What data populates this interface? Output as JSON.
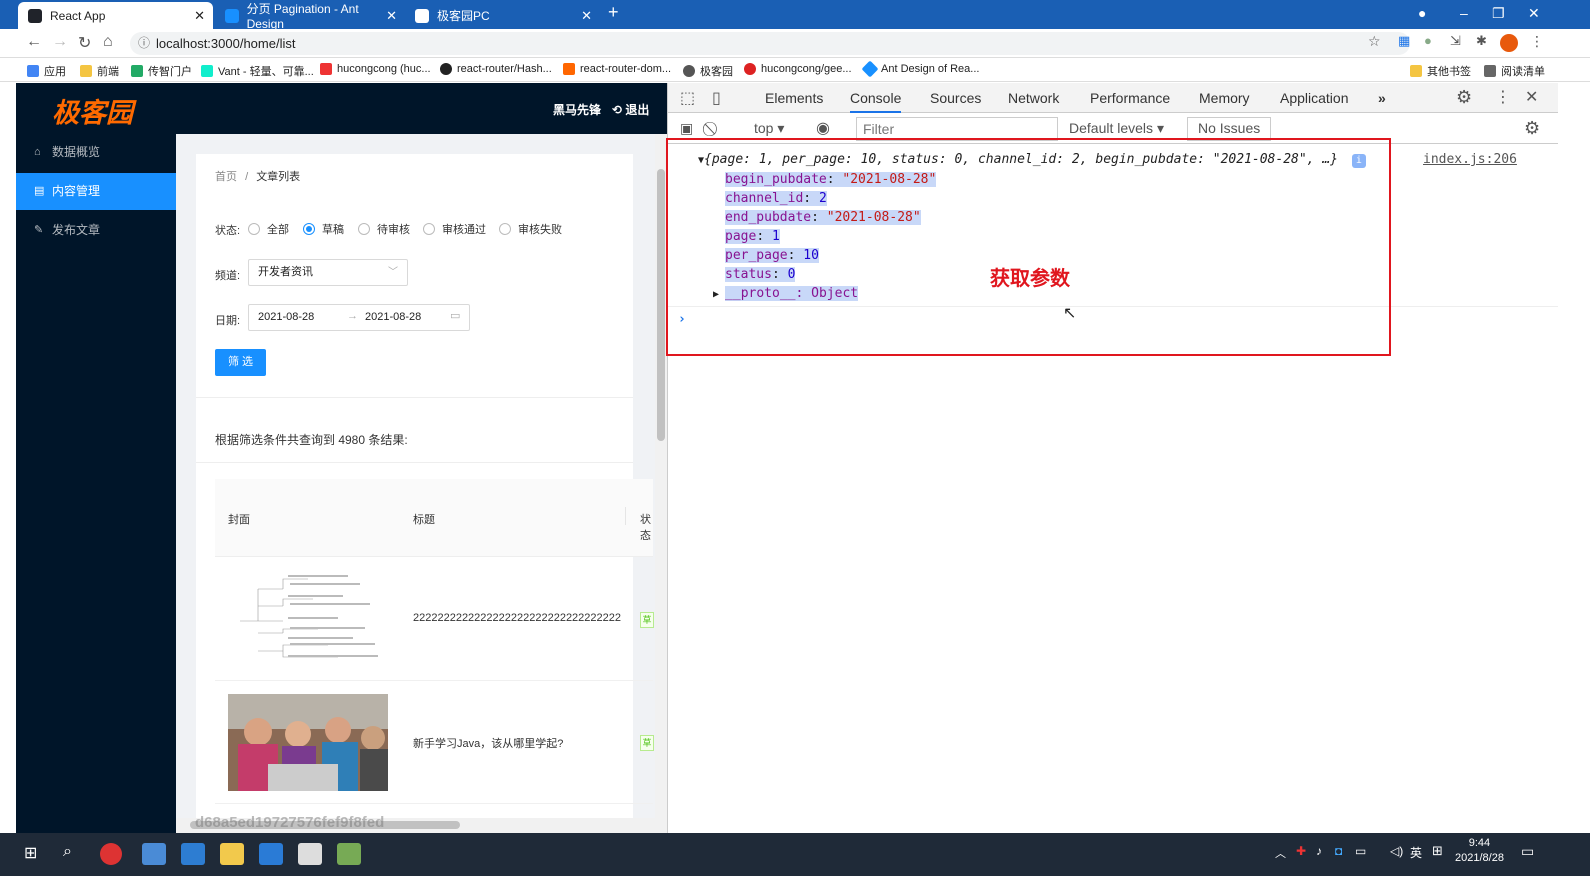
{
  "browser": {
    "tabs": [
      {
        "label": "React App",
        "color": "#20232a"
      },
      {
        "label": "分页 Pagination - Ant Design",
        "color": "#1890ff"
      },
      {
        "label": "极客园PC",
        "color": "#444"
      }
    ],
    "url": "localhost:3000/home/list",
    "bookmarks": [
      "应用",
      "前端",
      "传智门户",
      "Vant - 轻量、可靠...",
      "hucongcong (huc...",
      "react-router/Hash...",
      "react-router-dom...",
      "极客园",
      "hucongcong/gee...",
      "Ant Design of Rea...",
      "其他书签",
      "阅读清单"
    ]
  },
  "app": {
    "logo": "极客园",
    "user": "黑马先锋",
    "logout": "退出",
    "menu": [
      "数据概览",
      "内容管理",
      "发布文章"
    ],
    "breadcrumb": {
      "home": "首页",
      "sep": "/",
      "current": "文章列表"
    },
    "status_label": "状态:",
    "statuses": [
      "全部",
      "草稿",
      "待审核",
      "审核通过",
      "审核失败"
    ],
    "channel_label": "频道:",
    "channel_value": "开发者资讯",
    "date_label": "日期:",
    "date_start": "2021-08-28",
    "date_end": "2021-08-28",
    "filter_button": "筛 选",
    "result_text": "根据筛选条件共查询到 4980 条结果:",
    "table_headers": [
      "封面",
      "标题",
      "状态"
    ],
    "rows": [
      {
        "title": "2222222222222222222222222222222222",
        "tag": "草"
      },
      {
        "title": "新手学习Java，该从哪里学起?",
        "tag": "草"
      }
    ]
  },
  "devtools": {
    "tabs": [
      "Elements",
      "Console",
      "Sources",
      "Network",
      "Performance",
      "Memory",
      "Application"
    ],
    "context": "top",
    "filter_placeholder": "Filter",
    "levels": "Default levels",
    "issues": "No Issues",
    "source_link": "index.js:206",
    "summary": "{page: 1, per_page: 10, status: 0, channel_id: 2, begin_pubdate: \"2021-08-28\", …}",
    "props": [
      {
        "key": "begin_pubdate",
        "value": "\"2021-08-28\"",
        "type": "str"
      },
      {
        "key": "channel_id",
        "value": "2",
        "type": "num"
      },
      {
        "key": "end_pubdate",
        "value": "\"2021-08-28\"",
        "type": "str"
      },
      {
        "key": "page",
        "value": "1",
        "type": "num"
      },
      {
        "key": "per_page",
        "value": "10",
        "type": "num"
      },
      {
        "key": "status",
        "value": "0",
        "type": "num"
      }
    ],
    "proto": "__proto__: Object",
    "annotation": "获取参数"
  },
  "taskbar": {
    "time": "9:44",
    "date": "2021/8/28",
    "ime": "英"
  },
  "watermark": "d68a5ed19727576fef9f8fed"
}
